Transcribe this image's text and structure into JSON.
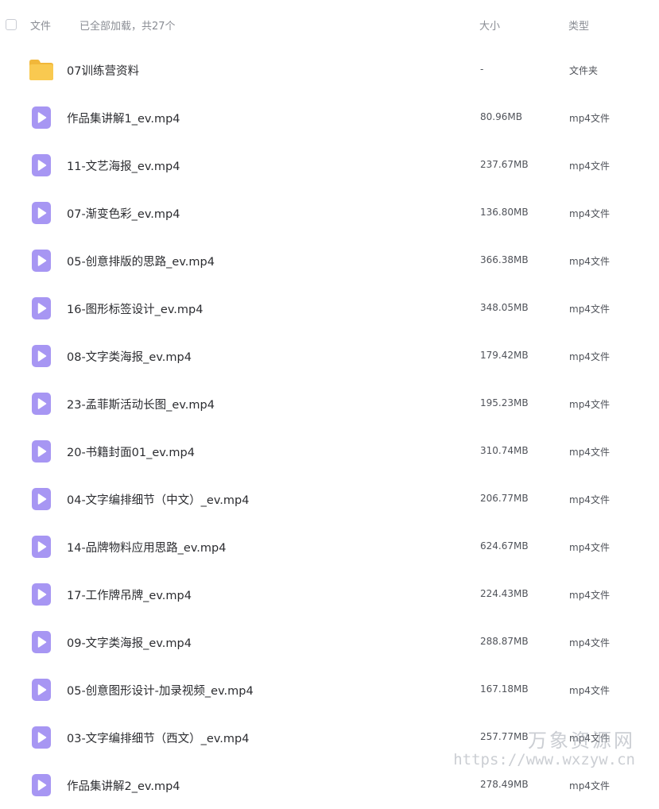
{
  "header": {
    "file_label": "文件",
    "status_text": "已全部加载，共27个",
    "size_label": "大小",
    "type_label": "类型"
  },
  "colors": {
    "folder": "#f9c950",
    "video_icon": "#a796f3",
    "header_text": "#8a8d94"
  },
  "files": [
    {
      "name": "07训练营资料",
      "size": "-",
      "type": "文件夹",
      "icon": "folder-icon"
    },
    {
      "name": "作品集讲解1_ev.mp4",
      "size": "80.96MB",
      "type": "mp4文件",
      "icon": "video-file-icon"
    },
    {
      "name": "11-文艺海报_ev.mp4",
      "size": "237.67MB",
      "type": "mp4文件",
      "icon": "video-file-icon"
    },
    {
      "name": "07-渐变色彩_ev.mp4",
      "size": "136.80MB",
      "type": "mp4文件",
      "icon": "video-file-icon"
    },
    {
      "name": "05-创意排版的思路_ev.mp4",
      "size": "366.38MB",
      "type": "mp4文件",
      "icon": "video-file-icon"
    },
    {
      "name": "16-图形标签设计_ev.mp4",
      "size": "348.05MB",
      "type": "mp4文件",
      "icon": "video-file-icon"
    },
    {
      "name": "08-文字类海报_ev.mp4",
      "size": "179.42MB",
      "type": "mp4文件",
      "icon": "video-file-icon"
    },
    {
      "name": "23-孟菲斯活动长图_ev.mp4",
      "size": "195.23MB",
      "type": "mp4文件",
      "icon": "video-file-icon"
    },
    {
      "name": "20-书籍封面01_ev.mp4",
      "size": "310.74MB",
      "type": "mp4文件",
      "icon": "video-file-icon"
    },
    {
      "name": "04-文字编排细节（中文）_ev.mp4",
      "size": "206.77MB",
      "type": "mp4文件",
      "icon": "video-file-icon"
    },
    {
      "name": "14-品牌物料应用思路_ev.mp4",
      "size": "624.67MB",
      "type": "mp4文件",
      "icon": "video-file-icon"
    },
    {
      "name": "17-工作牌吊牌_ev.mp4",
      "size": "224.43MB",
      "type": "mp4文件",
      "icon": "video-file-icon"
    },
    {
      "name": "09-文字类海报_ev.mp4",
      "size": "288.87MB",
      "type": "mp4文件",
      "icon": "video-file-icon"
    },
    {
      "name": "05-创意图形设计-加录视频_ev.mp4",
      "size": "167.18MB",
      "type": "mp4文件",
      "icon": "video-file-icon"
    },
    {
      "name": "03-文字编排细节（西文）_ev.mp4",
      "size": "257.77MB",
      "type": "mp4文件",
      "icon": "video-file-icon"
    },
    {
      "name": "作品集讲解2_ev.mp4",
      "size": "278.49MB",
      "type": "mp4文件",
      "icon": "video-file-icon"
    }
  ],
  "watermark": {
    "text_cn": "万象资源网",
    "url": "https://www.wxzyw.cn"
  }
}
